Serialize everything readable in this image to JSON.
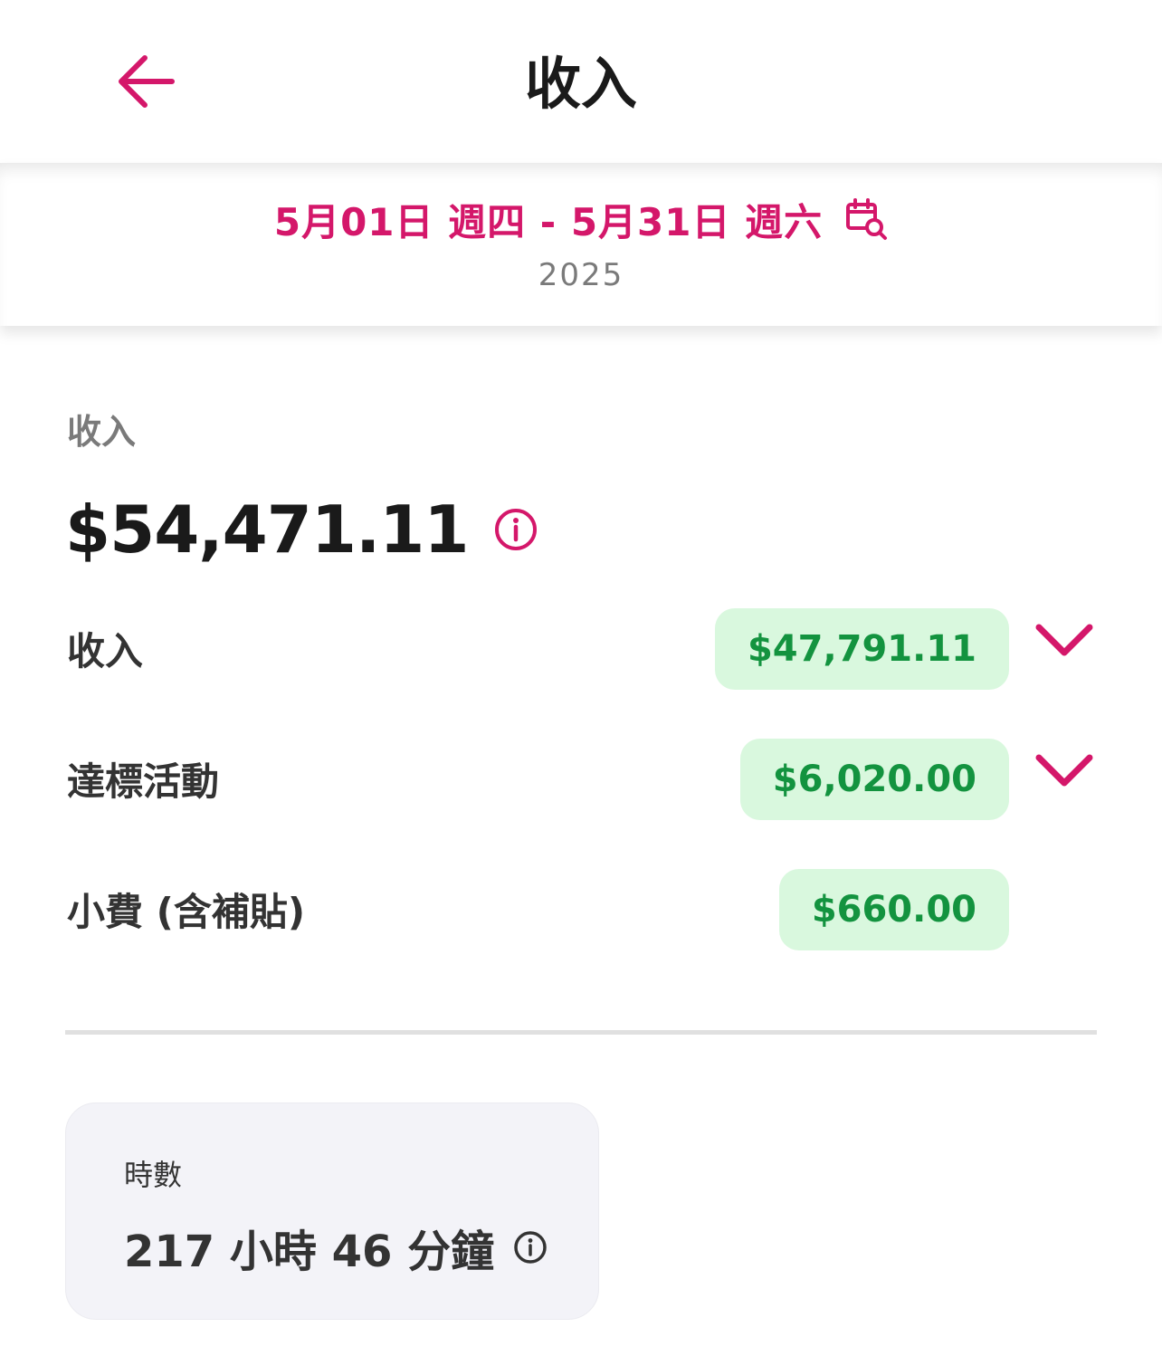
{
  "header": {
    "title": "收入",
    "back_icon": "arrow-left-icon",
    "accent_color": "#d4176a"
  },
  "date_filter": {
    "range": "5月01日 週四 - 5月31日 週六",
    "year": "2025",
    "icon": "calendar-search-icon"
  },
  "earnings": {
    "section_label": "收入",
    "total": "$54,471.11",
    "info_icon": "info-icon",
    "items": [
      {
        "label": "收入",
        "amount": "$47,791.11",
        "expandable": true
      },
      {
        "label": "達標活動",
        "amount": "$6,020.00",
        "expandable": true
      },
      {
        "label": "小費 (含補貼)",
        "amount": "$660.00",
        "expandable": false
      }
    ],
    "amount_color": "#13933f",
    "pill_color": "#d9f8de"
  },
  "hours": {
    "label": "時數",
    "value": "217 小時 46 分鐘",
    "info_icon": "info-icon"
  }
}
